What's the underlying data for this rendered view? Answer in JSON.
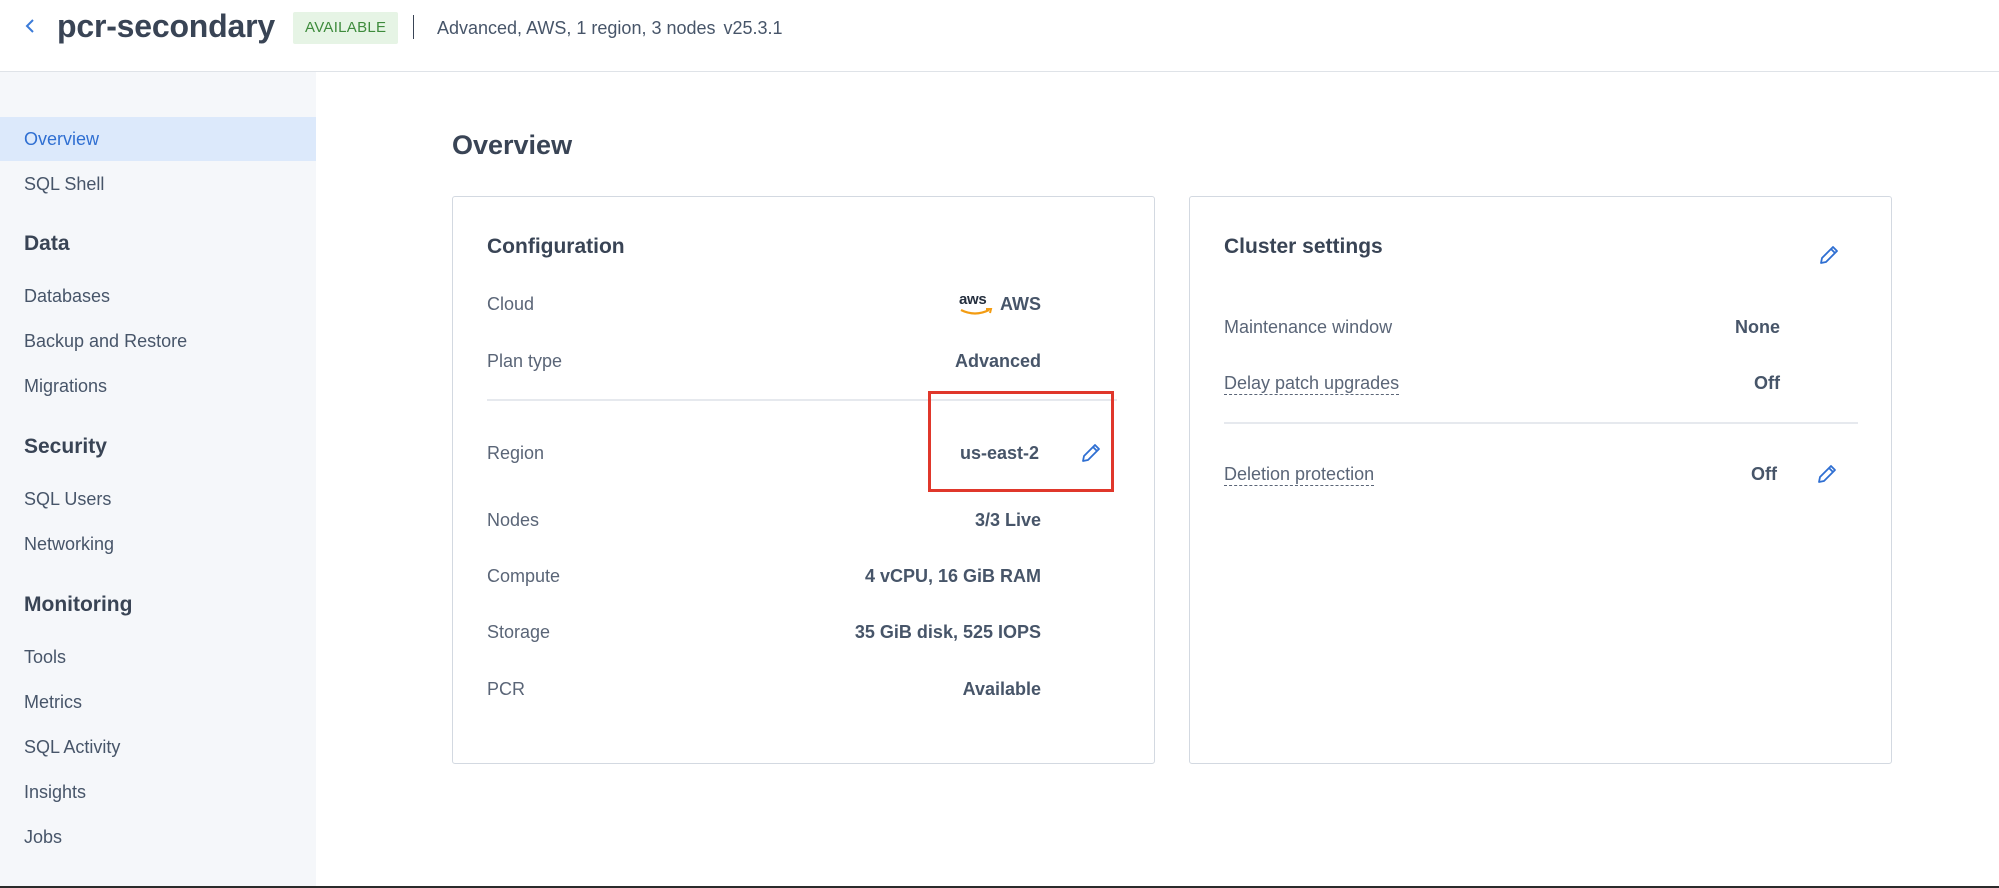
{
  "header": {
    "back_icon": "chevron-left-icon",
    "cluster_name": "pcr-secondary",
    "status": "AVAILABLE",
    "meta": "Advanced, AWS, 1 region, 3 nodes",
    "version": "v25.3.1"
  },
  "sidebar": {
    "top_items": [
      {
        "label": "Overview",
        "active": true
      },
      {
        "label": "SQL Shell",
        "active": false
      }
    ],
    "sections": [
      {
        "title": "Data",
        "items": [
          "Databases",
          "Backup and Restore",
          "Migrations"
        ]
      },
      {
        "title": "Security",
        "items": [
          "SQL Users",
          "Networking"
        ]
      },
      {
        "title": "Monitoring",
        "items": [
          "Tools",
          "Metrics",
          "SQL Activity",
          "Insights",
          "Jobs"
        ]
      }
    ]
  },
  "main": {
    "title": "Overview",
    "configuration": {
      "title": "Configuration",
      "rows": [
        {
          "label": "Cloud",
          "value": "AWS",
          "logo_text": "aws"
        },
        {
          "label": "Plan type",
          "value": "Advanced"
        },
        {
          "label": "Region",
          "value": "us-east-2",
          "editable": true
        },
        {
          "label": "Nodes",
          "value": "3/3 Live"
        },
        {
          "label": "Compute",
          "value": "4 vCPU, 16 GiB RAM"
        },
        {
          "label": "Storage",
          "value": "35 GiB disk, 525 IOPS"
        },
        {
          "label": "PCR",
          "value": "Available"
        }
      ]
    },
    "cluster_settings": {
      "title": "Cluster settings",
      "rows": [
        {
          "label": "Maintenance window",
          "value": "None"
        },
        {
          "label": "Delay patch upgrades",
          "value": "Off"
        },
        {
          "label": "Deletion protection",
          "value": "Off",
          "editable": true
        }
      ]
    }
  },
  "colors": {
    "accent": "#2f6fd2",
    "badge_bg": "#e6f4e5",
    "badge_text": "#3e8b3c",
    "highlight": "#e0372b",
    "sidebar_bg": "#f5f7fa",
    "sidebar_active_bg": "#dce9fb"
  }
}
